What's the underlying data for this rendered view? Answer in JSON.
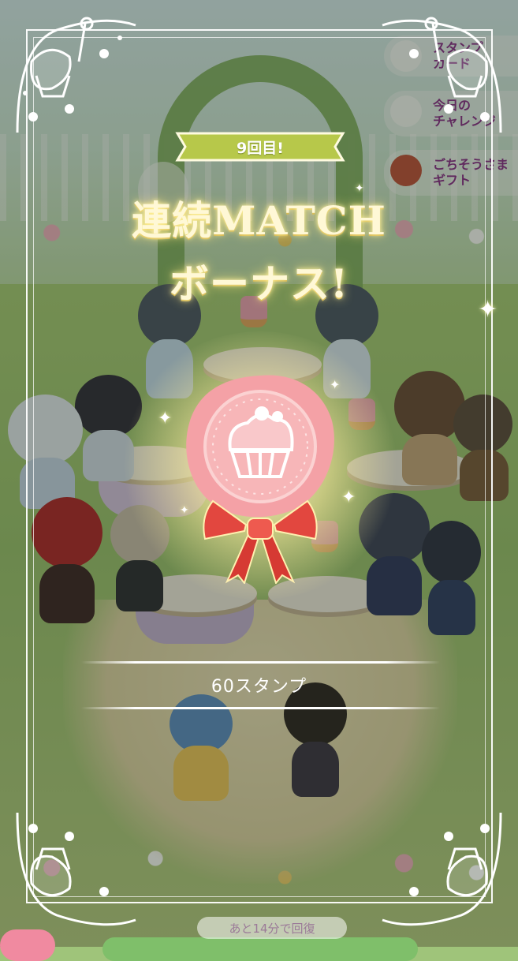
{
  "popup": {
    "count_label": "9回目!",
    "title_line1": "連続MATCH",
    "title_line2": "ボーナス!",
    "reward_text": "60スタンプ"
  },
  "side_buttons": [
    {
      "label": "スタンプ\nカード",
      "icon": "stamp-card-icon"
    },
    {
      "label": "今日の\nチャレンジ",
      "icon": "checklist-icon"
    },
    {
      "label": "ごちそうさま\nギフト",
      "icon": "character-portrait-icon"
    }
  ],
  "footer": {
    "recovery_text": "あと14分で回復"
  },
  "colors": {
    "badge_green": "#b7c84a",
    "title_glow": "#f7e27a",
    "seal_pink": "#f4a1a6",
    "ribbon_red": "#e2473f",
    "side_text": "#8a2c8c"
  },
  "icons": [
    "cupcake-icon",
    "fork-icon",
    "spoon-icon",
    "flower-icon",
    "sparkle-icon",
    "wax-seal-icon",
    "ribbon-icon"
  ]
}
